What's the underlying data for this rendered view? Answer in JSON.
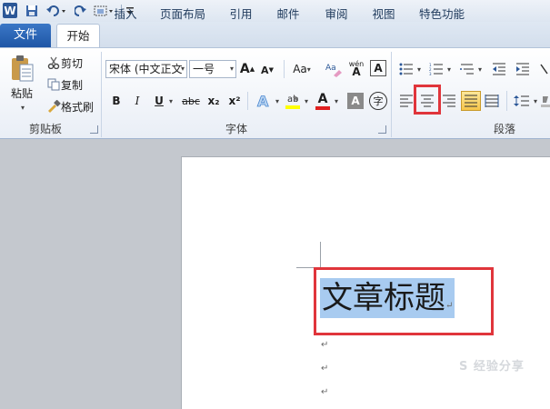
{
  "app_icon_letter": "W",
  "tabs": [
    "文件",
    "开始",
    "插入",
    "页面布局",
    "引用",
    "邮件",
    "审阅",
    "视图",
    "特色功能"
  ],
  "clipboard": {
    "paste": "粘贴",
    "cut": "剪切",
    "copy": "复制",
    "format_painter": "格式刷",
    "label": "剪贴板"
  },
  "font": {
    "name": "宋体 (中文正文",
    "size": "一号",
    "label": "字体",
    "grow": "A",
    "shrink": "A",
    "case": "Aa",
    "bold": "B",
    "italic": "I",
    "underline": "U",
    "strike": "abc",
    "sub": "x₂",
    "sup": "x²",
    "color_a": "A",
    "char_border": "A",
    "phonetic": "wén",
    "enclose": "字"
  },
  "paragraph": {
    "label": "段落"
  },
  "document": {
    "title_text": "文章标题",
    "para_mark": "↵"
  },
  "watermark": "S 经验分享",
  "colors": {
    "highlight_box": "#e0353b",
    "selection": "#a8cbf0",
    "file_tab": "#2b62b0"
  }
}
